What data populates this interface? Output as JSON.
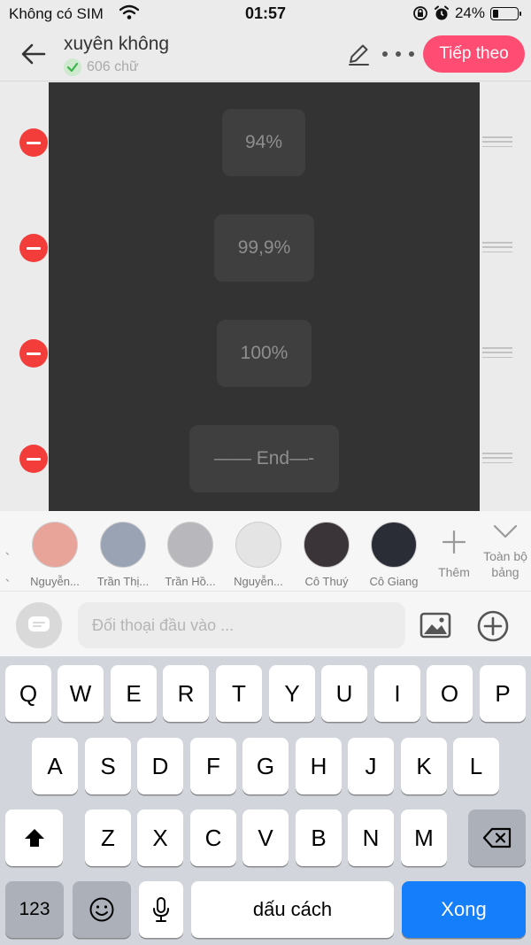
{
  "status": {
    "carrier": "Không có SIM",
    "time": "01:57",
    "battery": "24%",
    "battery_level": 0.24
  },
  "header": {
    "title": "xuyên không",
    "word_count": "606 chữ",
    "next_label": "Tiếp theo"
  },
  "rows": [
    {
      "text": "94%"
    },
    {
      "text": "99,9%"
    },
    {
      "text": "100%"
    },
    {
      "text": "—— End—-"
    }
  ],
  "characters": {
    "edge_marks": "、\n、\n、",
    "items": [
      {
        "name": "Nguyễn...",
        "color": "#e9a49a"
      },
      {
        "name": "Trần Thị...",
        "color": "#9aa3b4"
      },
      {
        "name": "Trần Hồ...",
        "color": "#b8b8bc"
      },
      {
        "name": "Nguyễn...",
        "color": "#e4e4e4"
      },
      {
        "name": "Cô Thuý",
        "color": "#3a3438"
      },
      {
        "name": "Cô Giang",
        "color": "#2a2d36"
      }
    ],
    "add_label": "Thêm",
    "collapse_label": "Toàn bộ bảng"
  },
  "input": {
    "placeholder": "Đối thoại đầu vào ..."
  },
  "keyboard": {
    "row1": [
      "Q",
      "W",
      "E",
      "R",
      "T",
      "Y",
      "U",
      "I",
      "O",
      "P"
    ],
    "row2": [
      "A",
      "S",
      "D",
      "F",
      "G",
      "H",
      "J",
      "K",
      "L"
    ],
    "row3": [
      "Z",
      "X",
      "C",
      "V",
      "B",
      "N",
      "M"
    ],
    "numbers_label": "123",
    "space_label": "dấu cách",
    "done_label": "Xong"
  },
  "colors": {
    "accent": "#ff4c72",
    "delete": "#f23d3a",
    "keyboard_done": "#147efb"
  }
}
